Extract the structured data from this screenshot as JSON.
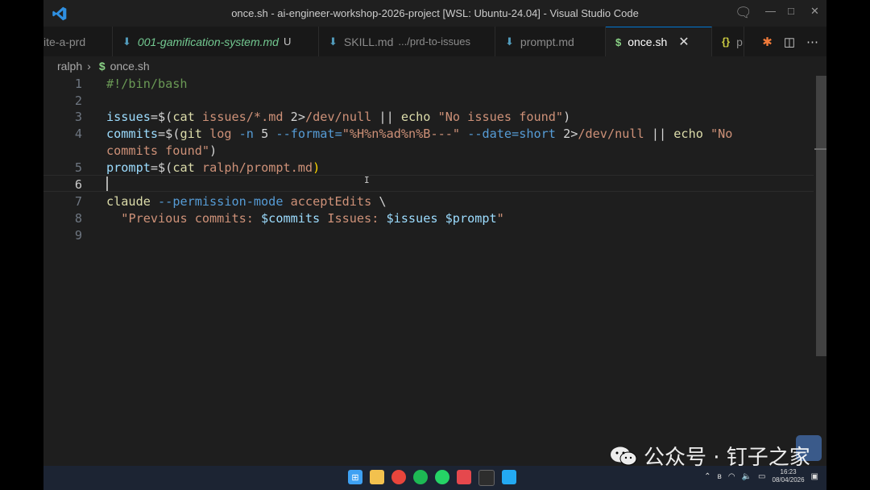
{
  "window": {
    "title": "once.sh - ai-engineer-workshop-2026-project [WSL: Ubuntu-24.04] - Visual Studio Code"
  },
  "tabs": [
    {
      "label": "ite-a-prd",
      "icon": "",
      "extra": "",
      "modified": ""
    },
    {
      "label": "001-gamification-system.md",
      "icon": "markdown-icon",
      "extra": "",
      "modified": "U"
    },
    {
      "label": "SKILL.md",
      "icon": "markdown-icon",
      "extra": ".../prd-to-issues",
      "modified": ""
    },
    {
      "label": "prompt.md",
      "icon": "markdown-icon",
      "extra": "",
      "modified": ""
    },
    {
      "label": "once.sh",
      "icon": "shell-icon",
      "extra": "",
      "modified": ""
    },
    {
      "label": "p",
      "icon": "json-icon",
      "extra": "",
      "modified": ""
    }
  ],
  "breadcrumb": {
    "folder": "ralph",
    "file": "once.sh"
  },
  "editor": {
    "line_numbers": [
      "1",
      "2",
      "3",
      "4",
      "",
      "5",
      "6",
      "7",
      "8",
      "9"
    ],
    "current_line": "6"
  },
  "taskbar": {
    "time": "16:23",
    "date": "08/04/2026"
  },
  "watermark": {
    "text": "公众号 · 钉子之家"
  },
  "colors": {
    "accent": "#0078d4",
    "editor_bg": "#1e1e1e",
    "string": "#ce9178",
    "variable": "#9cdcfe"
  }
}
